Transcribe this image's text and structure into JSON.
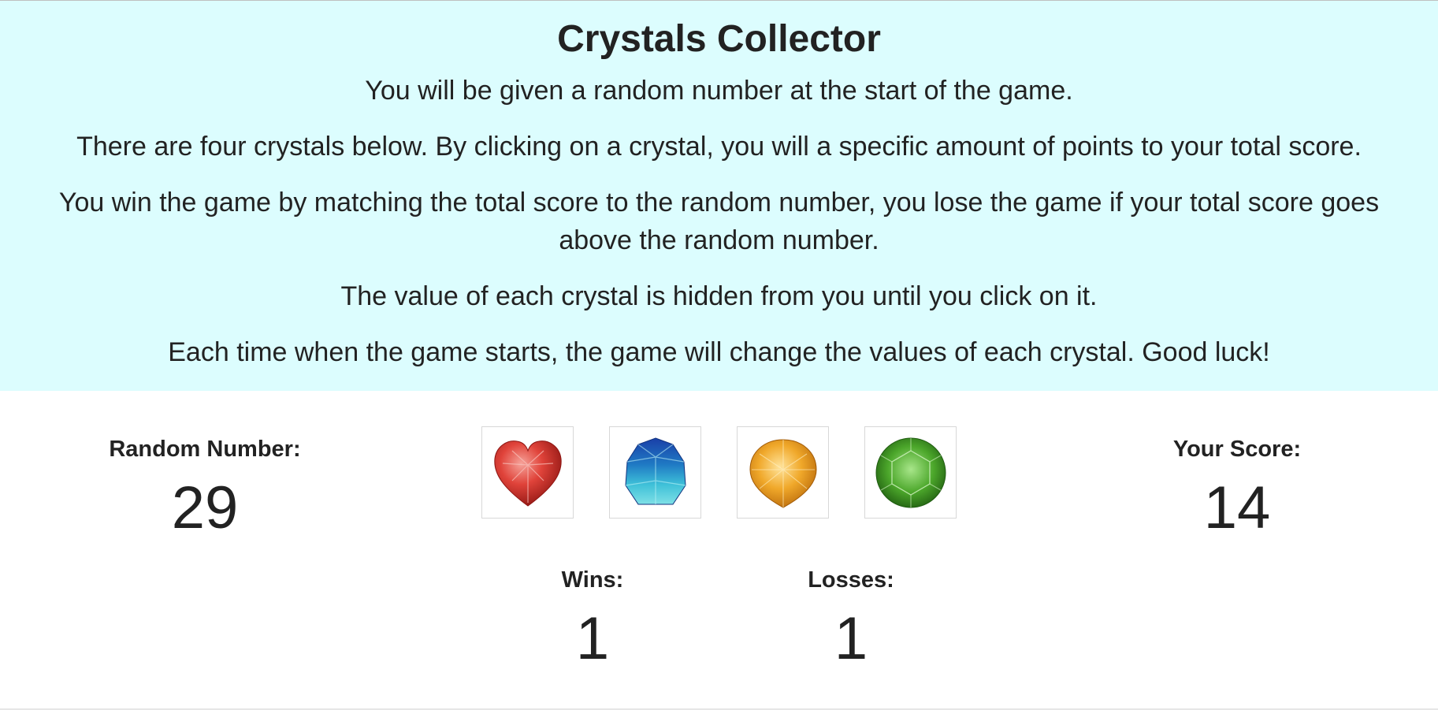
{
  "header": {
    "title": "Crystals Collector",
    "instructions": [
      "You will be given a random number at the start of the game.",
      "There are four crystals below. By clicking on a crystal, you will a specific amount of points to your total score.",
      "You win the game by matching the total score to the random number, you lose the game if your total score goes above the random number.",
      "The value of each crystal is hidden from you until you click on it.",
      "Each time when the game starts, the game will change the values of each crystal. Good luck!"
    ],
    "background_color": "#dcfdfe"
  },
  "game": {
    "random_number_label": "Random Number:",
    "random_number": "29",
    "score_label": "Your Score:",
    "score": "14",
    "wins_label": "Wins:",
    "wins": "1",
    "losses_label": "Losses:",
    "losses": "1",
    "crystals": [
      {
        "name": "red-heart-crystal",
        "color": "#d7352f"
      },
      {
        "name": "blue-crystal",
        "color": "#2fa7c6"
      },
      {
        "name": "yellow-crystal",
        "color": "#eaa21f"
      },
      {
        "name": "green-crystal",
        "color": "#3f9b23"
      }
    ]
  }
}
